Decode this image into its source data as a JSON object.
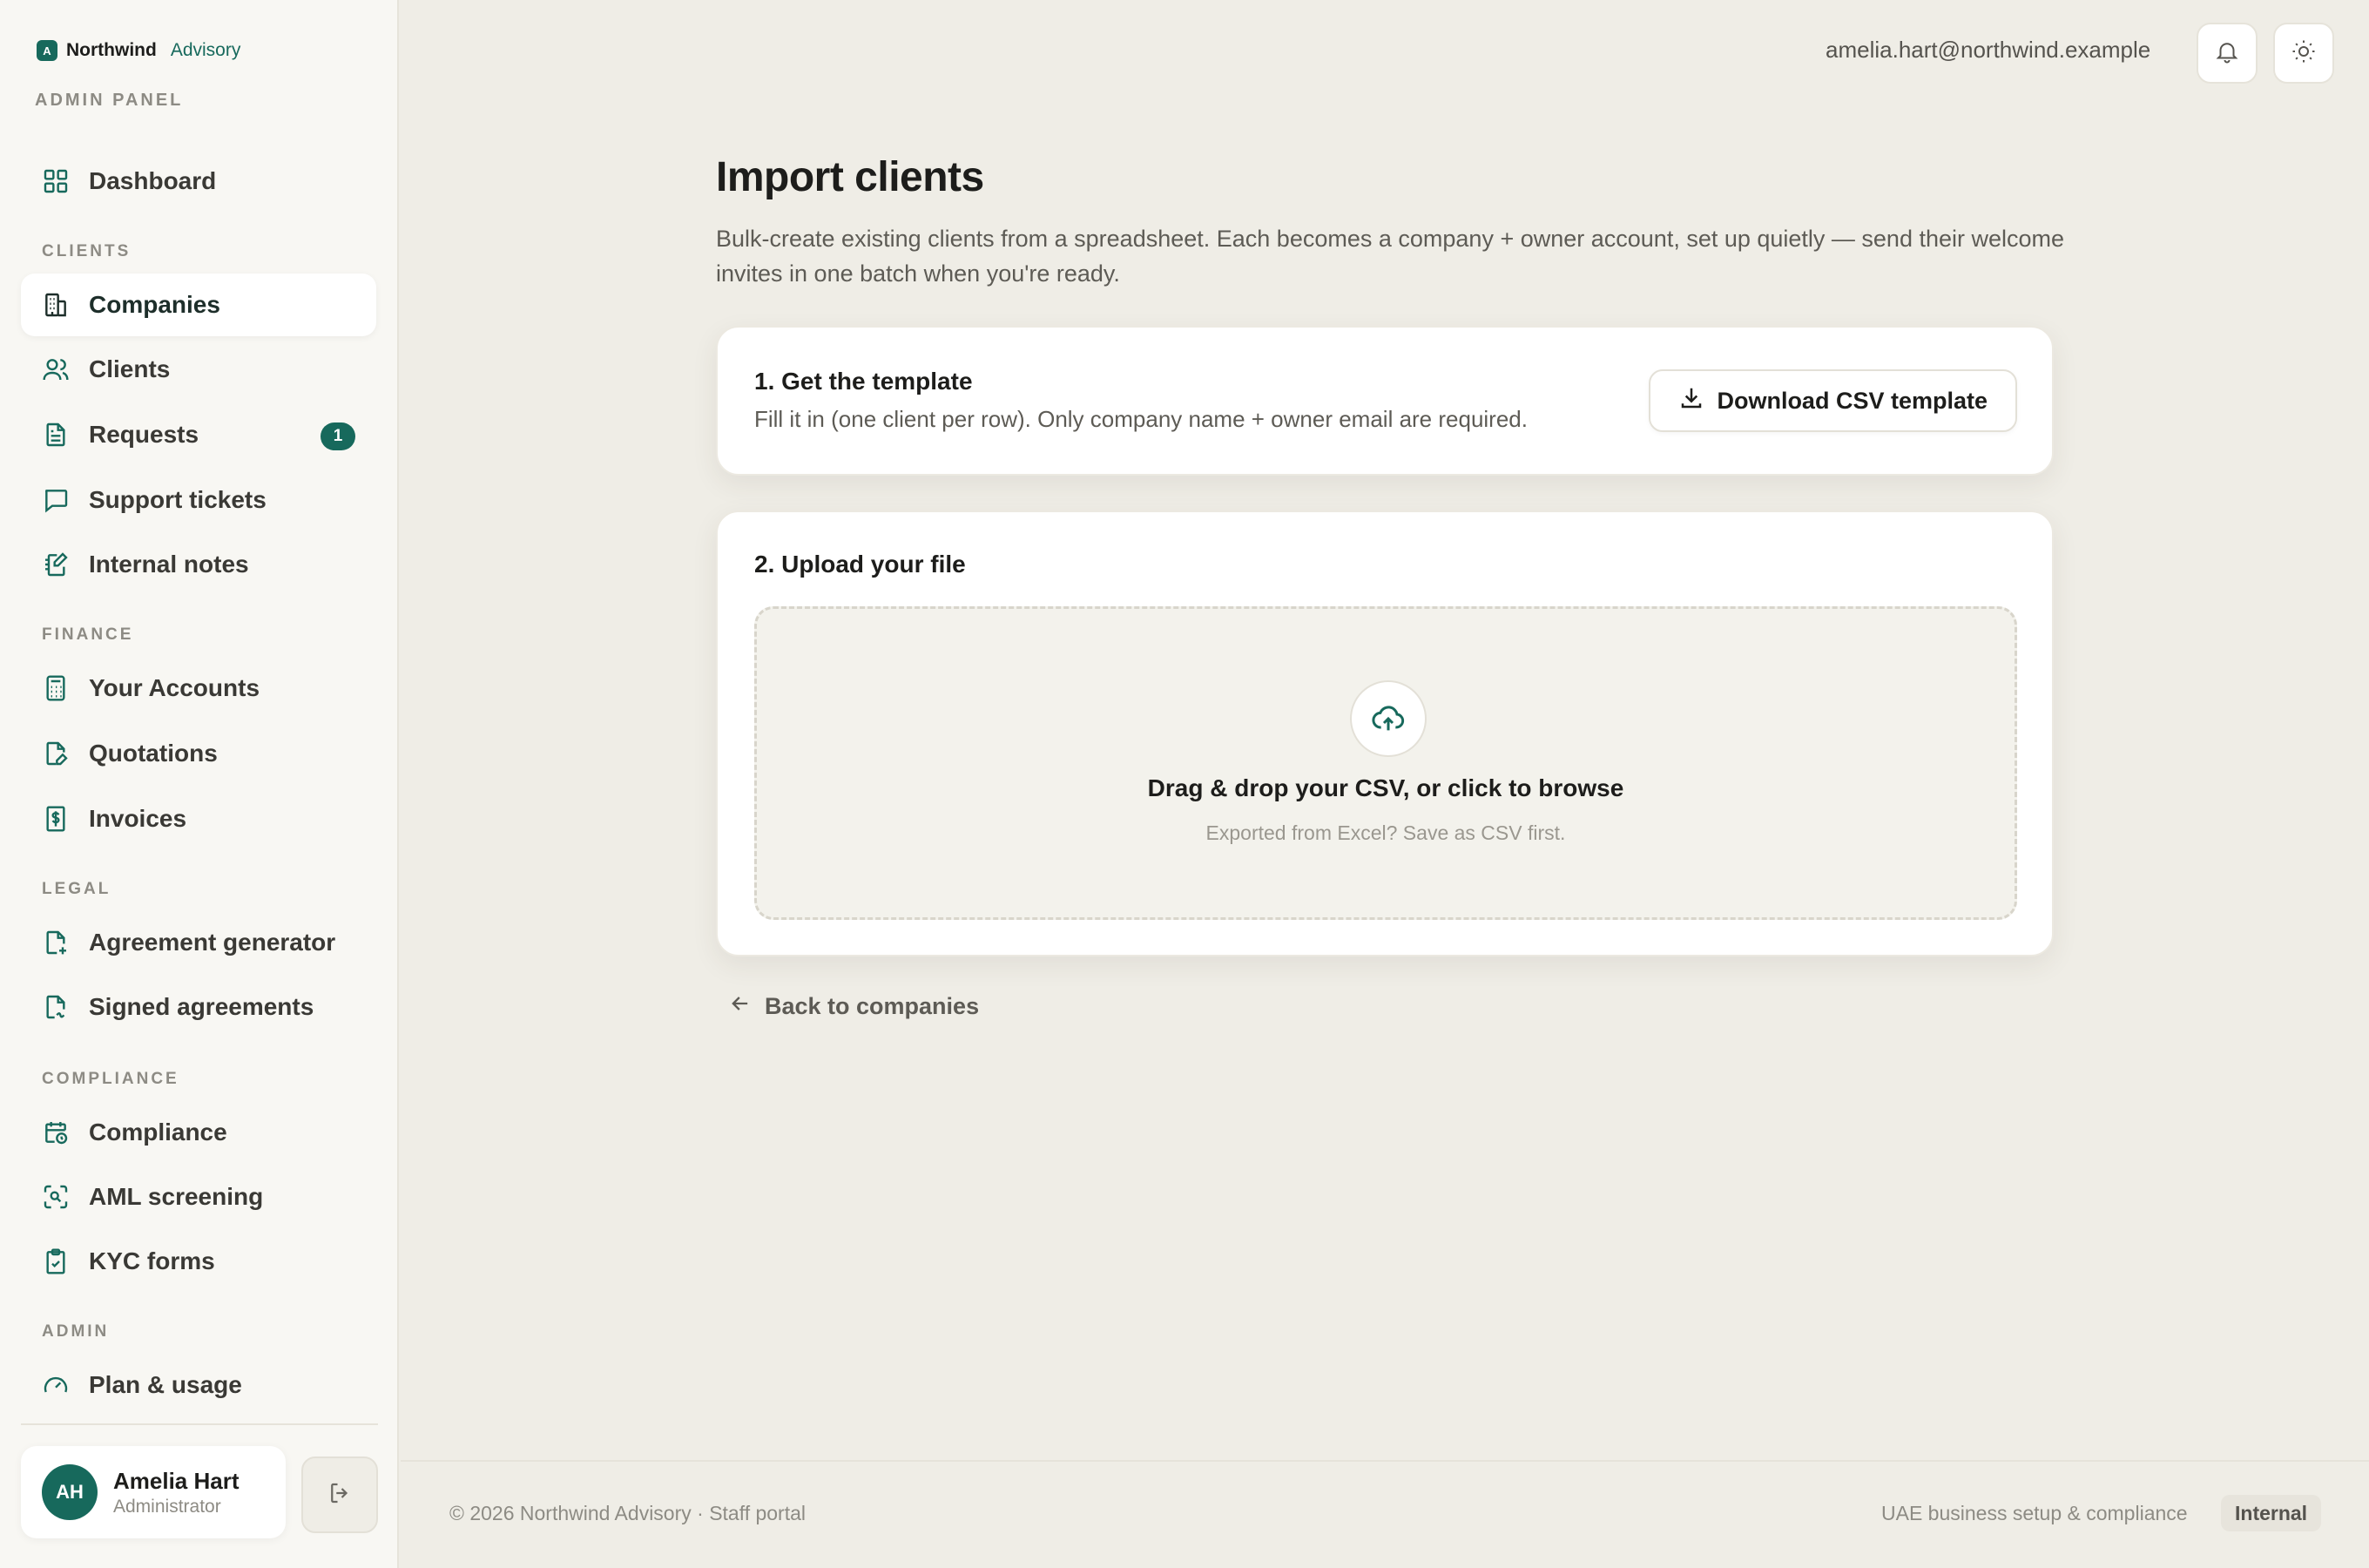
{
  "brand": {
    "logo_letter": "A",
    "name": "Northwind",
    "sub": "Advisory",
    "panel": "ADMIN PANEL"
  },
  "sidebar": {
    "sections": {
      "clients": "CLIENTS",
      "finance": "FINANCE",
      "legal": "LEGAL",
      "compliance": "COMPLIANCE",
      "admin": "ADMIN"
    },
    "items": [
      {
        "label": "Dashboard",
        "icon": "dashboard-grid-icon"
      },
      {
        "label": "Companies",
        "icon": "building-icon",
        "active": true
      },
      {
        "label": "Clients",
        "icon": "users-icon"
      },
      {
        "label": "Requests",
        "icon": "document-icon",
        "badge": "1"
      },
      {
        "label": "Support tickets",
        "icon": "chat-icon"
      },
      {
        "label": "Internal notes",
        "icon": "notebook-pen-icon"
      },
      {
        "label": "Your Accounts",
        "icon": "calculator-icon"
      },
      {
        "label": "Quotations",
        "icon": "file-pen-icon"
      },
      {
        "label": "Invoices",
        "icon": "receipt-dollar-icon"
      },
      {
        "label": "Agreement generator",
        "icon": "file-plus-icon"
      },
      {
        "label": "Signed agreements",
        "icon": "file-signature-icon"
      },
      {
        "label": "Compliance",
        "icon": "calendar-clock-icon"
      },
      {
        "label": "AML screening",
        "icon": "scan-search-icon"
      },
      {
        "label": "KYC forms",
        "icon": "clipboard-check-icon"
      },
      {
        "label": "Plan & usage",
        "icon": "gauge-icon"
      }
    ]
  },
  "user": {
    "initials": "AH",
    "name": "Amelia Hart",
    "role": "Administrator"
  },
  "topbar": {
    "email": "amelia.hart@northwind.example"
  },
  "main": {
    "title": "Import clients",
    "description": "Bulk-create existing clients from a spreadsheet. Each becomes a company + owner account, set up quietly — send their welcome invites in one batch when you're ready.",
    "step1": {
      "title": "1. Get the template",
      "subtitle": "Fill it in (one client per row). Only company name + owner email are required.",
      "button": "Download CSV template"
    },
    "step2": {
      "title": "2. Upload your file",
      "drop_title": "Drag & drop your CSV, or click to browse",
      "drop_hint": "Exported from Excel? Save as CSV first."
    },
    "back_link": "Back to companies"
  },
  "footer": {
    "copyright": "© 2026 Northwind Advisory · Staff portal",
    "tagline": "UAE business setup & compliance",
    "pill": "Internal"
  },
  "colors": {
    "accent": "#17695c",
    "background": "#efede6",
    "sidebar": "#f8f7f3"
  }
}
